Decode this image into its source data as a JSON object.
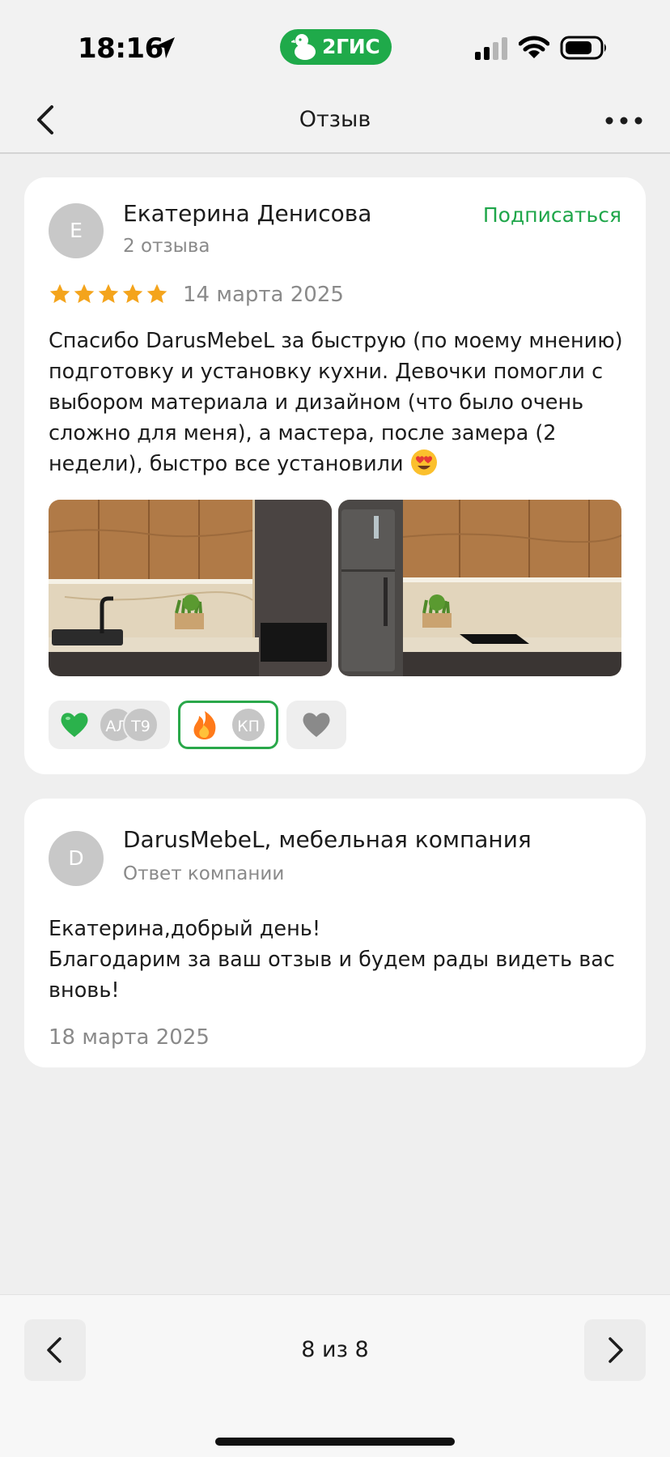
{
  "status_bar": {
    "time": "18:16",
    "brand": "2ГИС"
  },
  "nav": {
    "title": "Отзыв"
  },
  "review": {
    "author": {
      "initial": "Е",
      "name": "Екатерина Денисова",
      "reviews_count": "2 отзыва"
    },
    "subscribe_label": "Подписаться",
    "rating": 5,
    "date": "14 марта 2025",
    "text": "Спасибо DarusMebeL за быструю (по моему мнению) подготовку и установку кухни. Девочки помогли с выбором материала и дизайном (что было очень сложно для меня), а мастера, после замера (2 недели), быстро все установили",
    "text_emoji": "heart-eyes-emoji",
    "photos": [
      "kitchen-photo-1",
      "kitchen-photo-2"
    ],
    "reactions": [
      {
        "icon": "green-heart-icon",
        "users": [
          "АЛ",
          "Т9"
        ],
        "selected": false
      },
      {
        "icon": "fire-icon",
        "users": [
          "КП"
        ],
        "selected": true
      },
      {
        "icon": "gray-heart-icon",
        "users": [],
        "selected": false
      }
    ]
  },
  "reply": {
    "author": {
      "initial": "D",
      "name": "DarusMebeL, мебельная компания",
      "role": "Ответ компании"
    },
    "text": "Екатерина,добрый день!\nБлагодарим за ваш отзыв и будем рады видеть вас вновь!",
    "date": "18 марта 2025"
  },
  "pager": {
    "position": "8 из 8"
  },
  "colors": {
    "accent_green": "#1fa64a",
    "star": "#f4a41c",
    "background": "#efefef"
  }
}
